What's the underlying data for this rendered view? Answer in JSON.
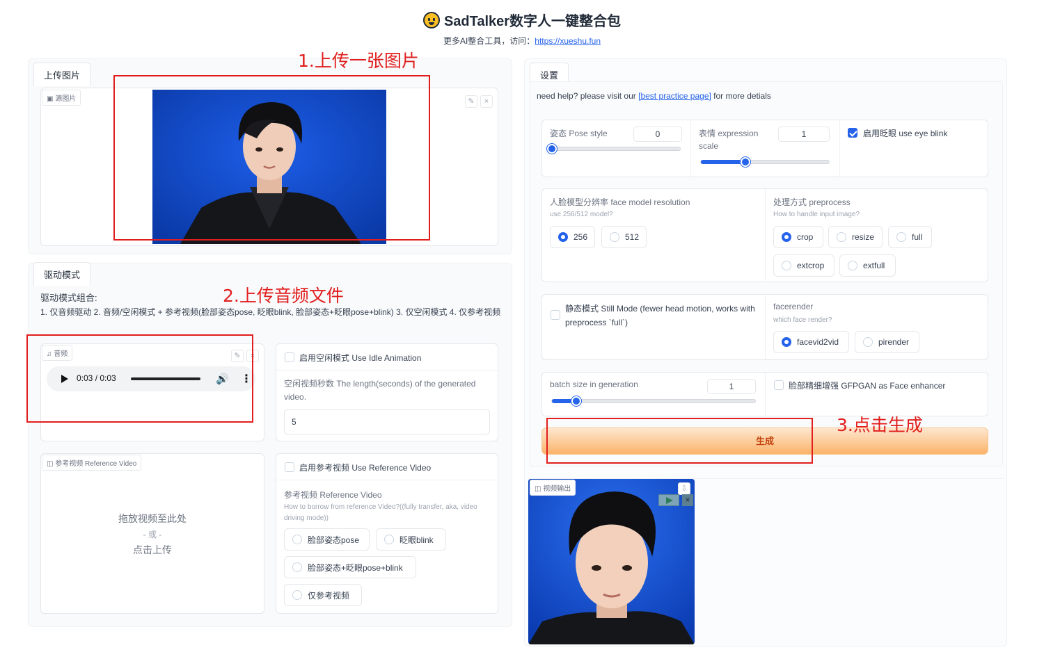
{
  "header": {
    "title": "SadTalker数字人一键整合包",
    "subtitle_prefix": "更多AI整合工具，访问：",
    "subtitle_link": "https://xueshu.fun"
  },
  "annotations": {
    "step1": "1.上传一张图片",
    "step2": "2.上传音频文件",
    "step3": "3.点击生成"
  },
  "left": {
    "upload_tab": "上传图片",
    "source_label": "源图片",
    "drive_tab": "驱动模式",
    "drive_title": "驱动模式组合:",
    "drive_desc": "1. 仅音频驱动 2. 音频/空闲模式 + 参考视频(脸部姿态pose, 眨眼blink, 脸部姿态+眨眼pose+blink) 3. 仅空闲模式 4. 仅参考视频",
    "audio_label": "音频",
    "audio_time": "0:03 / 0:03",
    "idle_checkbox": "启用空闲模式 Use Idle Animation",
    "idle_length_label": "空闲视频秒数 The length(seconds) of the generated video.",
    "idle_length_value": "5",
    "ref_video_label": "参考视频 Reference Video",
    "drop_text": "拖放视频至此处",
    "or_text": "- 或 -",
    "click_upload": "点击上传",
    "use_ref_checkbox": "启用参考视频 Use Reference Video",
    "ref_title": "参考视频 Reference Video",
    "ref_desc": "How to borrow from reference Video?((fully transfer, aka, video driving mode))",
    "ref_options": [
      "脸部姿态pose",
      "眨眼blink",
      "脸部姿态+眨眼pose+blink",
      "仅参考视频"
    ]
  },
  "right": {
    "settings_tab": "设置",
    "help_prefix": "need help? please visit our ",
    "help_link": "[best practice page]",
    "help_suffix": " for more detials",
    "pose_label": "姿态 Pose style",
    "pose_value": "0",
    "pose_level": 0,
    "expr_label": "表情 expression scale",
    "expr_value": "1",
    "expr_level": 0.35,
    "eye_blink": "启用眨眼 use eye blink",
    "res_label": "人脸模型分辨率 face model resolution",
    "res_hint": "use 256/512 model?",
    "res_options": [
      "256",
      "512"
    ],
    "pre_label": "处理方式 preprocess",
    "pre_hint": "How to handle input image?",
    "pre_options": [
      "crop",
      "resize",
      "full",
      "extcrop",
      "extfull"
    ],
    "still_label": "静态模式 Still Mode (fewer head motion, works with preprocess `full`)",
    "render_label": "facerender",
    "render_hint": "which face render?",
    "render_options": [
      "facevid2vid",
      "pirender"
    ],
    "batch_label": "batch size in generation",
    "batch_value": "1",
    "batch_level": 0.12,
    "gfpgan": "脸部精细增强 GFPGAN as Face enhancer",
    "generate": "生成",
    "output_label": "视频输出"
  },
  "colors": {
    "accent": "#2563eb",
    "generate_from": "#fde7cf",
    "generate_to": "#fbb36a",
    "annotation_red": "#e11d1d"
  }
}
